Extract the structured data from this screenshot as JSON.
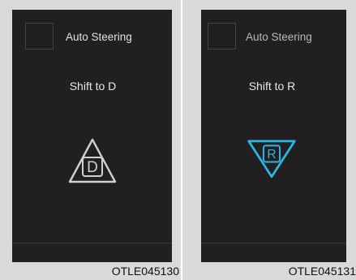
{
  "panels": [
    {
      "title": "Auto Steering",
      "message": "Shift to D",
      "gear": "D",
      "gear_icon": "triangle-up-icon",
      "gear_color": "#d0d0d0",
      "caption": "OTLE045130"
    },
    {
      "title": "Auto Steering",
      "message": "Shift to R",
      "gear": "R",
      "gear_icon": "triangle-down-icon",
      "gear_color": "#2fb5e4",
      "caption": "OTLE045131"
    }
  ],
  "colors": {
    "screen_background": "#211f20",
    "page_background": "#d9d9d9"
  }
}
